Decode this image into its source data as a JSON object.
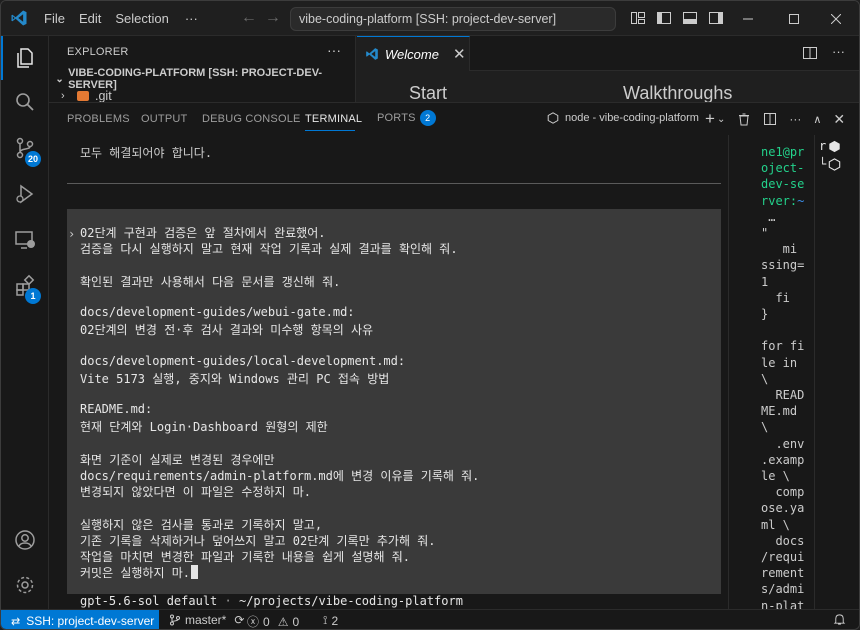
{
  "titlebar": {
    "menu": [
      "File",
      "Edit",
      "Selection"
    ],
    "more": "···",
    "command_center": "vibe-coding-platform [SSH: project-dev-server]"
  },
  "activitybar": {
    "source_control_badge": "20",
    "extensions_badge": "1"
  },
  "sidebar": {
    "title": "EXPLORER",
    "more": "···",
    "folder": "VIBE-CODING-PLATFORM [SSH: PROJECT-DEV-SERVER]",
    "items": [
      ".git"
    ]
  },
  "editor": {
    "tab": "Welcome",
    "headings": [
      "Start",
      "Walkthroughs"
    ]
  },
  "panel": {
    "tabs": [
      "PROBLEMS",
      "OUTPUT",
      "DEBUG CONSOLE",
      "TERMINAL",
      "PORTS"
    ],
    "ports_badge": "2",
    "terminal_name": "node - vibe-coding-platform"
  },
  "terminal": {
    "top_line": "모두 해결되어야 합니다.",
    "prompt_lines": [
      "02단계 구현과 검증은 앞 절차에서 완료했어.",
      "검증을 다시 실행하지 말고 현재 작업 기록과 실제 결과를 확인해 줘.",
      "",
      "확인된 결과만 사용해서 다음 문서를 갱신해 줘.",
      "",
      "docs/development-guides/webui-gate.md:",
      "02단계의 변경 전·후 검사 결과와 미수행 항목의 사유",
      "",
      "docs/development-guides/local-development.md:",
      "Vite 5173 실행, 중지와 Windows 관리 PC 접속 방법",
      "",
      "README.md:",
      "현재 단계와 Login·Dashboard 원형의 제한",
      "",
      "화면 기준이 실제로 변경된 경우에만",
      "docs/requirements/admin-platform.md에 변경 이유를 기록해 줘.",
      "변경되지 않았다면 이 파일은 수정하지 마.",
      "",
      "실행하지 않은 검사를 통과로 기록하지 말고,",
      "기존 기록을 삭제하거나 덮어쓰지 말고 02단계 기록만 추가해 줘.",
      "작업을 마치면 변경한 파일과 기록한 내용을 쉽게 설명해 줘.",
      "커밋은 실행하지 마."
    ],
    "footer_model": "gpt-5.6-sol default",
    "footer_sep": "·",
    "footer_path": "~/projects/vibe-coding-platform"
  },
  "terminal2": {
    "lines": [
      {
        "t": "ne1@pr",
        "c": "green"
      },
      {
        "t": "oject-",
        "c": "green"
      },
      {
        "t": "dev-se",
        "c": "green"
      },
      {
        "t": "rver:~",
        "c": "greenblue"
      },
      {
        "t": " …",
        "c": ""
      },
      {
        "t": "\"",
        "c": ""
      },
      {
        "t": "   mi",
        "c": ""
      },
      {
        "t": "ssing=",
        "c": ""
      },
      {
        "t": "1",
        "c": ""
      },
      {
        "t": "  fi",
        "c": ""
      },
      {
        "t": "}",
        "c": ""
      },
      {
        "t": "",
        "c": ""
      },
      {
        "t": "for fi",
        "c": ""
      },
      {
        "t": "le in",
        "c": ""
      },
      {
        "t": "\\",
        "c": ""
      },
      {
        "t": "  READ",
        "c": ""
      },
      {
        "t": "ME.md",
        "c": ""
      },
      {
        "t": "\\",
        "c": ""
      },
      {
        "t": "  .env",
        "c": ""
      },
      {
        "t": ".examp",
        "c": ""
      },
      {
        "t": "le \\",
        "c": ""
      },
      {
        "t": "  comp",
        "c": ""
      },
      {
        "t": "ose.ya",
        "c": ""
      },
      {
        "t": "ml \\",
        "c": ""
      },
      {
        "t": "  docs",
        "c": ""
      },
      {
        "t": "/requi",
        "c": ""
      },
      {
        "t": "rement",
        "c": ""
      },
      {
        "t": "s/admi",
        "c": ""
      },
      {
        "t": "n-plat",
        "c": ""
      }
    ],
    "list": [
      "r",
      "└"
    ]
  },
  "statusbar": {
    "remote": "SSH: project-dev-server",
    "branch": "master*",
    "errors": "0",
    "warnings": "0",
    "ports": "2"
  },
  "colors": {
    "accent": "#0078d4",
    "background": "#1f1f1f",
    "terminal_prompt_bg": "#3a3a3a"
  }
}
